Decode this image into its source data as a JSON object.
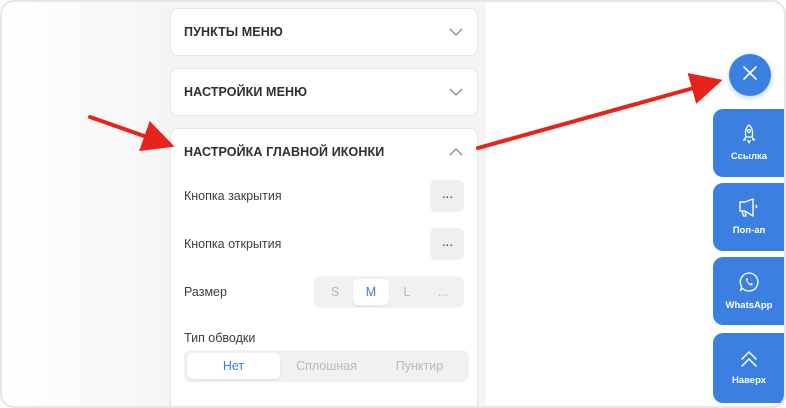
{
  "sections": {
    "menu_items": {
      "title": "ПУНКТЫ МЕНЮ"
    },
    "menu_settings": {
      "title": "НАСТРОЙКИ МЕНЮ"
    },
    "main_icon": {
      "title": "НАСТРОЙКА ГЛАВНОЙ ИКОНКИ",
      "close_button_label": "Кнопка закрытия",
      "open_button_label": "Кнопка открытия",
      "dots": "···",
      "size_label": "Размер",
      "size_options": [
        "S",
        "M",
        "L",
        "..."
      ],
      "size_selected": "M",
      "stroke_label": "Тип обводки",
      "stroke_options": [
        "Нет",
        "Сплошная",
        "Пунктир"
      ],
      "stroke_selected": "Нет"
    }
  },
  "widget": {
    "accent_color": "#3b7fe0",
    "close_icon": "close-icon",
    "buttons": [
      {
        "label": "Ссылка",
        "icon": "rocket-icon"
      },
      {
        "label": "Поп-ап",
        "icon": "megaphone-icon"
      },
      {
        "label": "WhatsApp",
        "icon": "whatsapp-icon"
      },
      {
        "label": "Наверх",
        "icon": "double-chevron-up-icon"
      }
    ]
  },
  "annotations": {
    "arrow_color": "#e8231c"
  }
}
